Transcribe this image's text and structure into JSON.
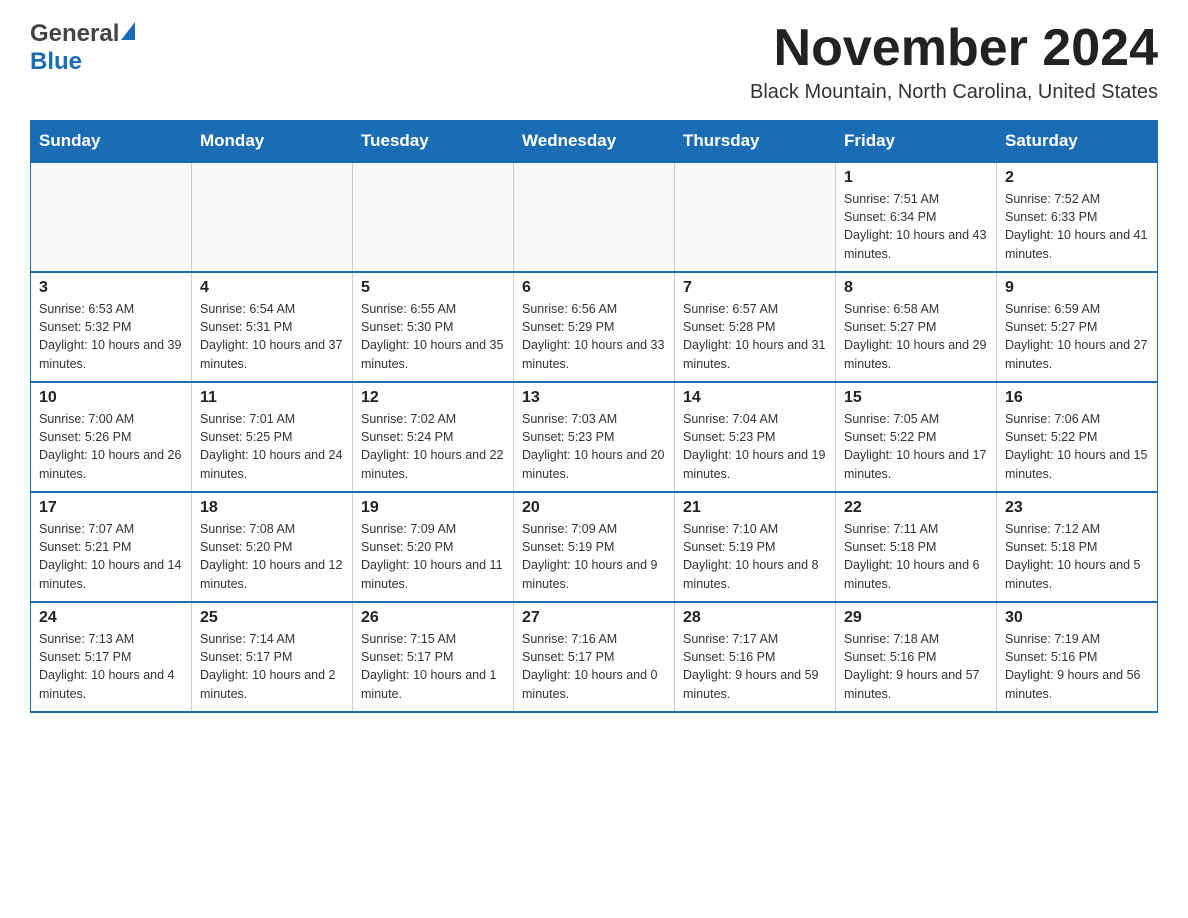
{
  "logo": {
    "general": "General",
    "flag": "",
    "blue": "Blue"
  },
  "header": {
    "title": "November 2024",
    "subtitle": "Black Mountain, North Carolina, United States"
  },
  "weekdays": [
    "Sunday",
    "Monday",
    "Tuesday",
    "Wednesday",
    "Thursday",
    "Friday",
    "Saturday"
  ],
  "weeks": [
    [
      {
        "day": "",
        "info": ""
      },
      {
        "day": "",
        "info": ""
      },
      {
        "day": "",
        "info": ""
      },
      {
        "day": "",
        "info": ""
      },
      {
        "day": "",
        "info": ""
      },
      {
        "day": "1",
        "info": "Sunrise: 7:51 AM\nSunset: 6:34 PM\nDaylight: 10 hours and 43 minutes."
      },
      {
        "day": "2",
        "info": "Sunrise: 7:52 AM\nSunset: 6:33 PM\nDaylight: 10 hours and 41 minutes."
      }
    ],
    [
      {
        "day": "3",
        "info": "Sunrise: 6:53 AM\nSunset: 5:32 PM\nDaylight: 10 hours and 39 minutes."
      },
      {
        "day": "4",
        "info": "Sunrise: 6:54 AM\nSunset: 5:31 PM\nDaylight: 10 hours and 37 minutes."
      },
      {
        "day": "5",
        "info": "Sunrise: 6:55 AM\nSunset: 5:30 PM\nDaylight: 10 hours and 35 minutes."
      },
      {
        "day": "6",
        "info": "Sunrise: 6:56 AM\nSunset: 5:29 PM\nDaylight: 10 hours and 33 minutes."
      },
      {
        "day": "7",
        "info": "Sunrise: 6:57 AM\nSunset: 5:28 PM\nDaylight: 10 hours and 31 minutes."
      },
      {
        "day": "8",
        "info": "Sunrise: 6:58 AM\nSunset: 5:27 PM\nDaylight: 10 hours and 29 minutes."
      },
      {
        "day": "9",
        "info": "Sunrise: 6:59 AM\nSunset: 5:27 PM\nDaylight: 10 hours and 27 minutes."
      }
    ],
    [
      {
        "day": "10",
        "info": "Sunrise: 7:00 AM\nSunset: 5:26 PM\nDaylight: 10 hours and 26 minutes."
      },
      {
        "day": "11",
        "info": "Sunrise: 7:01 AM\nSunset: 5:25 PM\nDaylight: 10 hours and 24 minutes."
      },
      {
        "day": "12",
        "info": "Sunrise: 7:02 AM\nSunset: 5:24 PM\nDaylight: 10 hours and 22 minutes."
      },
      {
        "day": "13",
        "info": "Sunrise: 7:03 AM\nSunset: 5:23 PM\nDaylight: 10 hours and 20 minutes."
      },
      {
        "day": "14",
        "info": "Sunrise: 7:04 AM\nSunset: 5:23 PM\nDaylight: 10 hours and 19 minutes."
      },
      {
        "day": "15",
        "info": "Sunrise: 7:05 AM\nSunset: 5:22 PM\nDaylight: 10 hours and 17 minutes."
      },
      {
        "day": "16",
        "info": "Sunrise: 7:06 AM\nSunset: 5:22 PM\nDaylight: 10 hours and 15 minutes."
      }
    ],
    [
      {
        "day": "17",
        "info": "Sunrise: 7:07 AM\nSunset: 5:21 PM\nDaylight: 10 hours and 14 minutes."
      },
      {
        "day": "18",
        "info": "Sunrise: 7:08 AM\nSunset: 5:20 PM\nDaylight: 10 hours and 12 minutes."
      },
      {
        "day": "19",
        "info": "Sunrise: 7:09 AM\nSunset: 5:20 PM\nDaylight: 10 hours and 11 minutes."
      },
      {
        "day": "20",
        "info": "Sunrise: 7:09 AM\nSunset: 5:19 PM\nDaylight: 10 hours and 9 minutes."
      },
      {
        "day": "21",
        "info": "Sunrise: 7:10 AM\nSunset: 5:19 PM\nDaylight: 10 hours and 8 minutes."
      },
      {
        "day": "22",
        "info": "Sunrise: 7:11 AM\nSunset: 5:18 PM\nDaylight: 10 hours and 6 minutes."
      },
      {
        "day": "23",
        "info": "Sunrise: 7:12 AM\nSunset: 5:18 PM\nDaylight: 10 hours and 5 minutes."
      }
    ],
    [
      {
        "day": "24",
        "info": "Sunrise: 7:13 AM\nSunset: 5:17 PM\nDaylight: 10 hours and 4 minutes."
      },
      {
        "day": "25",
        "info": "Sunrise: 7:14 AM\nSunset: 5:17 PM\nDaylight: 10 hours and 2 minutes."
      },
      {
        "day": "26",
        "info": "Sunrise: 7:15 AM\nSunset: 5:17 PM\nDaylight: 10 hours and 1 minute."
      },
      {
        "day": "27",
        "info": "Sunrise: 7:16 AM\nSunset: 5:17 PM\nDaylight: 10 hours and 0 minutes."
      },
      {
        "day": "28",
        "info": "Sunrise: 7:17 AM\nSunset: 5:16 PM\nDaylight: 9 hours and 59 minutes."
      },
      {
        "day": "29",
        "info": "Sunrise: 7:18 AM\nSunset: 5:16 PM\nDaylight: 9 hours and 57 minutes."
      },
      {
        "day": "30",
        "info": "Sunrise: 7:19 AM\nSunset: 5:16 PM\nDaylight: 9 hours and 56 minutes."
      }
    ]
  ]
}
